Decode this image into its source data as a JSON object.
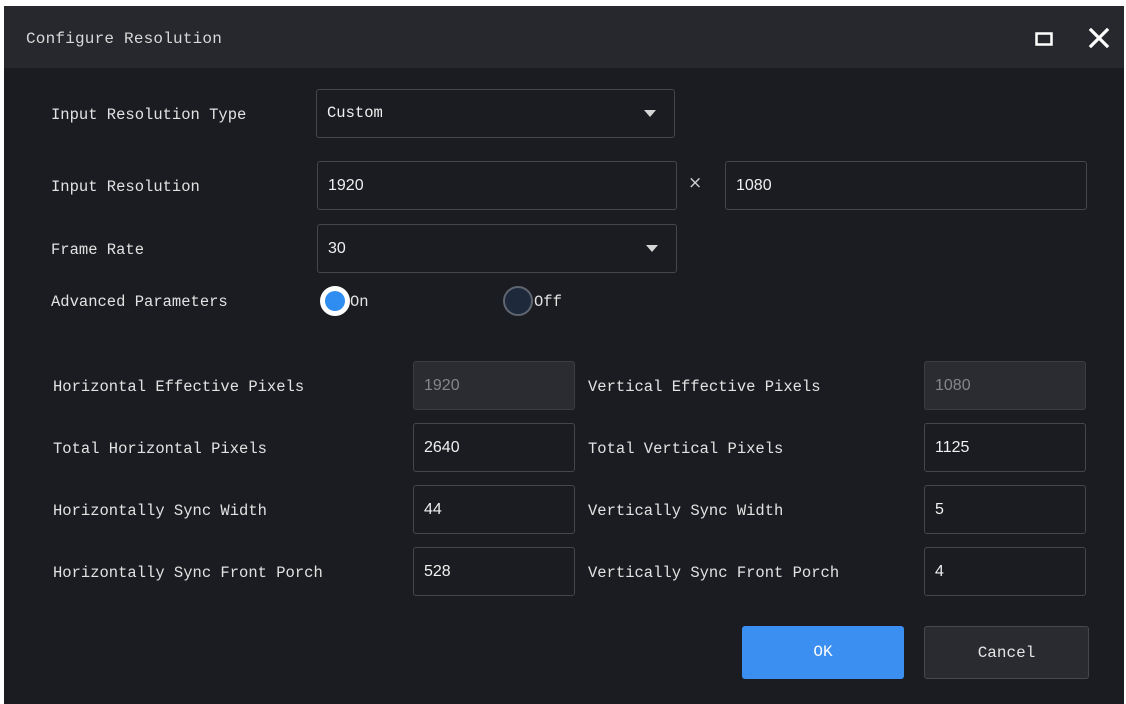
{
  "window": {
    "title": "Configure Resolution",
    "maximize_icon": "maximize-icon",
    "close_icon": "close-icon"
  },
  "input_resolution_type": {
    "label": "Input Resolution Type",
    "value": "Custom"
  },
  "input_resolution": {
    "label": "Input Resolution",
    "width": "1920",
    "separator": "×",
    "height": "1080"
  },
  "frame_rate": {
    "label": "Frame Rate",
    "value": "30"
  },
  "advanced_parameters": {
    "label": "Advanced Parameters",
    "on_label": "On",
    "off_label": "Off",
    "selected": "On"
  },
  "params": {
    "horizontal_effective_pixels": {
      "label": "Horizontal Effective Pixels",
      "value": "1920"
    },
    "vertical_effective_pixels": {
      "label": "Vertical Effective Pixels",
      "value": "1080"
    },
    "total_horizontal_pixels": {
      "label": "Total Horizontal Pixels",
      "value": "2640"
    },
    "total_vertical_pixels": {
      "label": "Total Vertical Pixels",
      "value": "1125"
    },
    "horizontal_sync_width": {
      "label": "Horizontally Sync Width",
      "value": "44"
    },
    "vertical_sync_width": {
      "label": "Vertically Sync Width",
      "value": "5"
    },
    "horizontal_front_porch": {
      "label": "Horizontally Sync Front Porch",
      "value": "528"
    },
    "vertical_front_porch": {
      "label": "Vertically Sync Front Porch",
      "value": "4"
    }
  },
  "buttons": {
    "ok_label": "OK",
    "cancel_label": "Cancel"
  },
  "colors": {
    "background": "#1b1c21",
    "titlebar": "#27282d",
    "accent": "#3a8ff0"
  }
}
